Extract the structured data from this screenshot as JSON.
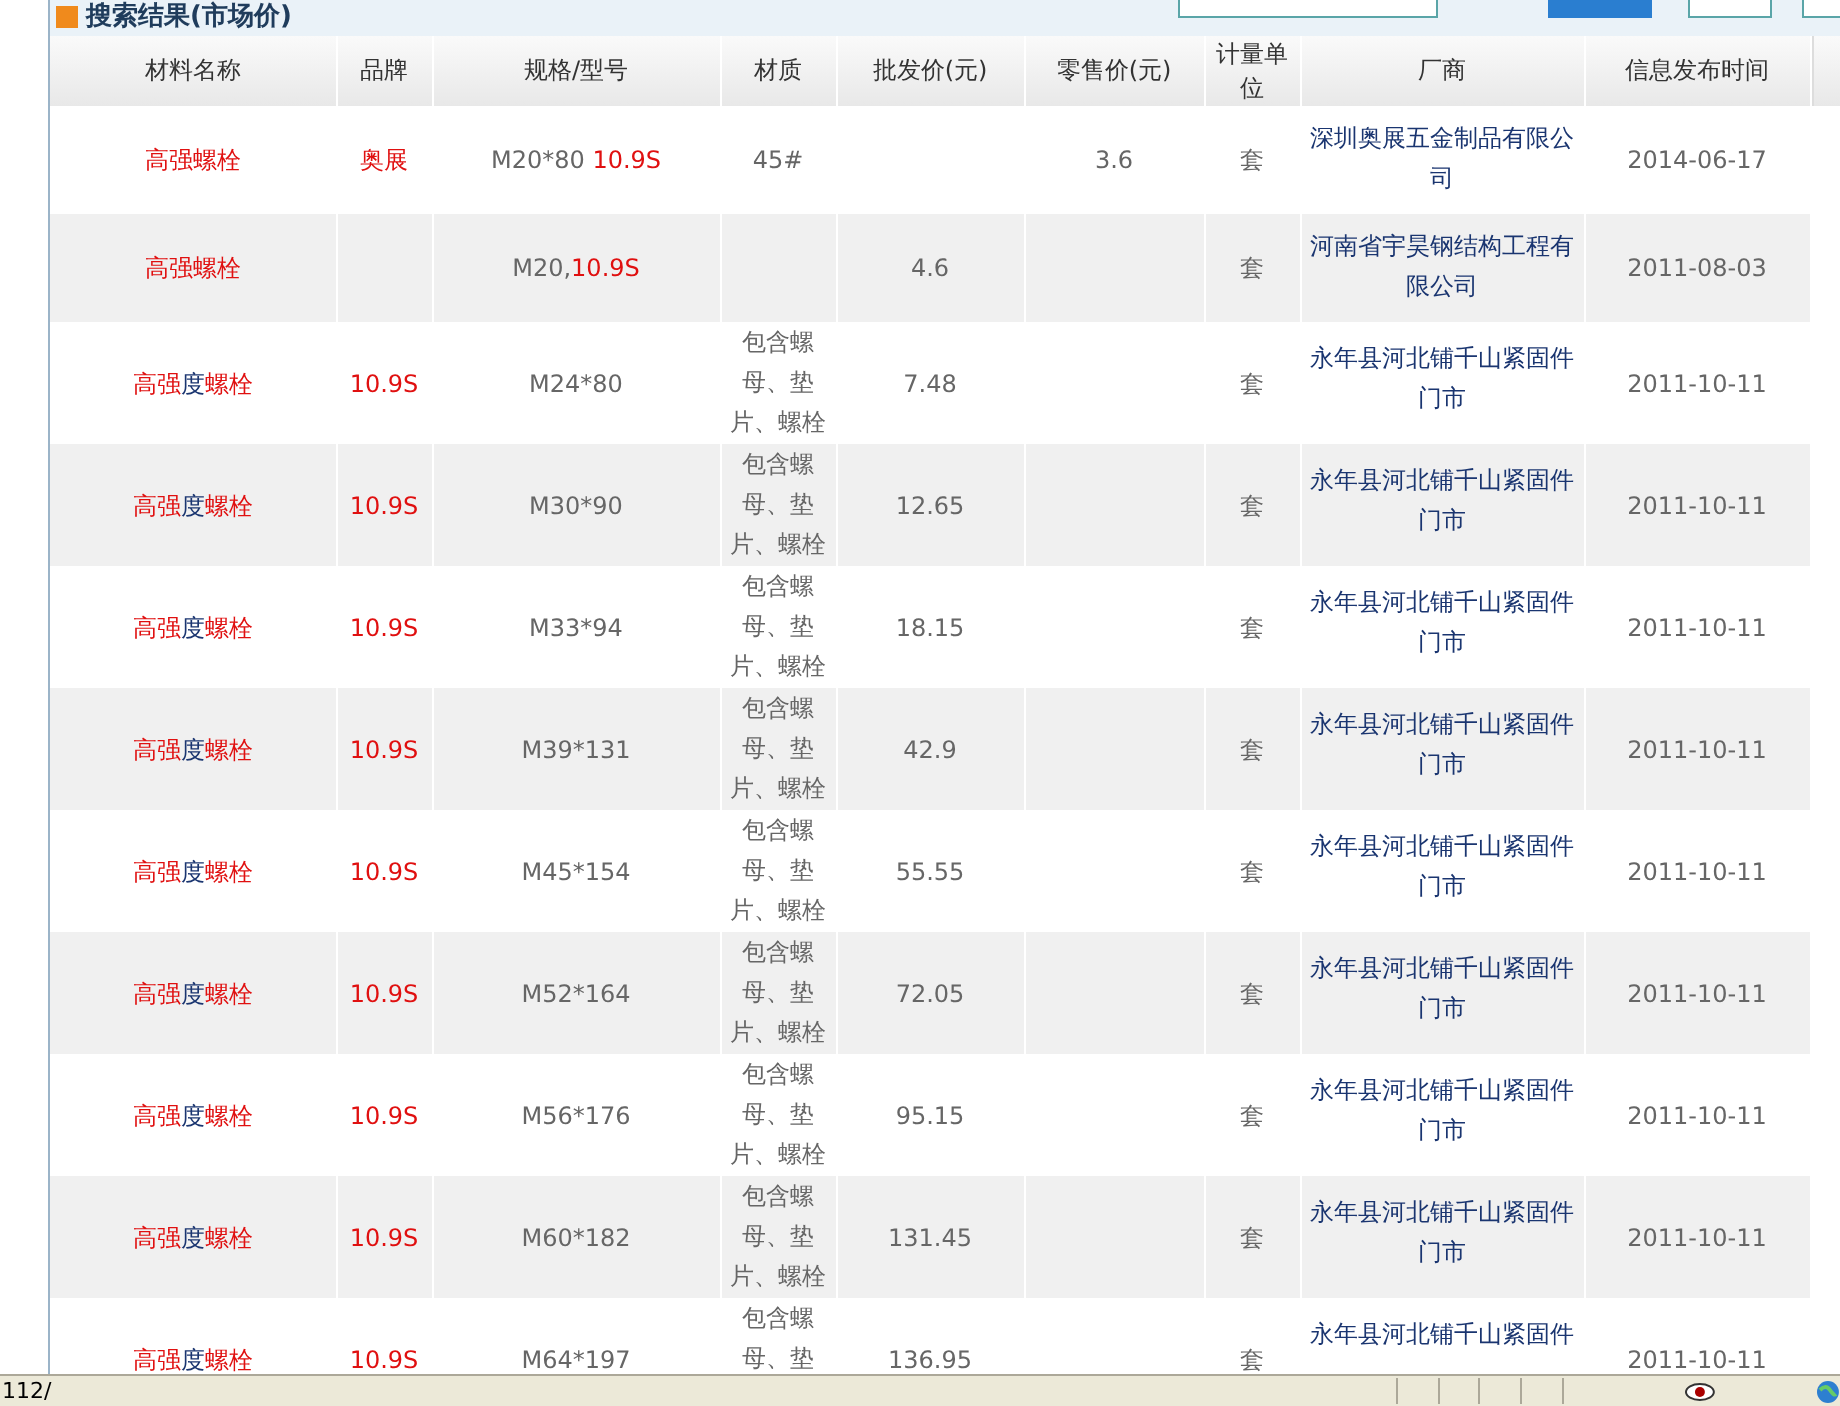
{
  "title": "搜索结果(市场价)",
  "columns": [
    "材料名称",
    "品牌",
    "规格/型号",
    "材质",
    "批发价(元)",
    "零售价(元)",
    "计量单位",
    "厂商",
    "信息发布时间"
  ],
  "rows": [
    {
      "name": [
        {
          "text": "高强螺栓",
          "red": true
        }
      ],
      "brand": "奥展",
      "spec": [
        {
          "text": "M20*80 ",
          "red": false
        },
        {
          "text": "10.9S",
          "red": true
        }
      ],
      "material": "45#",
      "wholesale": "",
      "retail": "3.6",
      "unit": "套",
      "factory": "深圳奥展五金制品有限公司",
      "date": "2014-06-17"
    },
    {
      "name": [
        {
          "text": "高强螺栓",
          "red": true
        }
      ],
      "brand": "",
      "spec": [
        {
          "text": "M20,",
          "red": false
        },
        {
          "text": "10.9S",
          "red": true
        }
      ],
      "material": "",
      "wholesale": "4.6",
      "retail": "",
      "unit": "套",
      "factory": "河南省宇昊钢结构工程有限公司",
      "date": "2011-08-03"
    },
    {
      "name": [
        {
          "text": "高强",
          "red": true
        },
        {
          "text": "度",
          "red": false
        },
        {
          "text": "螺栓",
          "red": true
        }
      ],
      "brand": "10.9S",
      "spec": [
        {
          "text": "M24*80",
          "red": false
        }
      ],
      "material": "包含螺母、垫片、螺栓",
      "wholesale": "7.48",
      "retail": "",
      "unit": "套",
      "factory": "永年县河北铺千山紧固件门市",
      "date": "2011-10-11"
    },
    {
      "name": [
        {
          "text": "高强",
          "red": true
        },
        {
          "text": "度",
          "red": false
        },
        {
          "text": "螺栓",
          "red": true
        }
      ],
      "brand": "10.9S",
      "spec": [
        {
          "text": "M30*90",
          "red": false
        }
      ],
      "material": "包含螺母、垫片、螺栓",
      "wholesale": "12.65",
      "retail": "",
      "unit": "套",
      "factory": "永年县河北铺千山紧固件门市",
      "date": "2011-10-11"
    },
    {
      "name": [
        {
          "text": "高强",
          "red": true
        },
        {
          "text": "度",
          "red": false
        },
        {
          "text": "螺栓",
          "red": true
        }
      ],
      "brand": "10.9S",
      "spec": [
        {
          "text": "M33*94",
          "red": false
        }
      ],
      "material": "包含螺母、垫片、螺栓",
      "wholesale": "18.15",
      "retail": "",
      "unit": "套",
      "factory": "永年县河北铺千山紧固件门市",
      "date": "2011-10-11"
    },
    {
      "name": [
        {
          "text": "高强",
          "red": true
        },
        {
          "text": "度",
          "red": false
        },
        {
          "text": "螺栓",
          "red": true
        }
      ],
      "brand": "10.9S",
      "spec": [
        {
          "text": "M39*131",
          "red": false
        }
      ],
      "material": "包含螺母、垫片、螺栓",
      "wholesale": "42.9",
      "retail": "",
      "unit": "套",
      "factory": "永年县河北铺千山紧固件门市",
      "date": "2011-10-11"
    },
    {
      "name": [
        {
          "text": "高强",
          "red": true
        },
        {
          "text": "度",
          "red": false
        },
        {
          "text": "螺栓",
          "red": true
        }
      ],
      "brand": "10.9S",
      "spec": [
        {
          "text": "M45*154",
          "red": false
        }
      ],
      "material": "包含螺母、垫片、螺栓",
      "wholesale": "55.55",
      "retail": "",
      "unit": "套",
      "factory": "永年县河北铺千山紧固件门市",
      "date": "2011-10-11"
    },
    {
      "name": [
        {
          "text": "高强",
          "red": true
        },
        {
          "text": "度",
          "red": false
        },
        {
          "text": "螺栓",
          "red": true
        }
      ],
      "brand": "10.9S",
      "spec": [
        {
          "text": "M52*164",
          "red": false
        }
      ],
      "material": "包含螺母、垫片、螺栓",
      "wholesale": "72.05",
      "retail": "",
      "unit": "套",
      "factory": "永年县河北铺千山紧固件门市",
      "date": "2011-10-11"
    },
    {
      "name": [
        {
          "text": "高强",
          "red": true
        },
        {
          "text": "度",
          "red": false
        },
        {
          "text": "螺栓",
          "red": true
        }
      ],
      "brand": "10.9S",
      "spec": [
        {
          "text": "M56*176",
          "red": false
        }
      ],
      "material": "包含螺母、垫片、螺栓",
      "wholesale": "95.15",
      "retail": "",
      "unit": "套",
      "factory": "永年县河北铺千山紧固件门市",
      "date": "2011-10-11"
    },
    {
      "name": [
        {
          "text": "高强",
          "red": true
        },
        {
          "text": "度",
          "red": false
        },
        {
          "text": "螺栓",
          "red": true
        }
      ],
      "brand": "10.9S",
      "spec": [
        {
          "text": "M60*182",
          "red": false
        }
      ],
      "material": "包含螺母、垫片、螺栓",
      "wholesale": "131.45",
      "retail": "",
      "unit": "套",
      "factory": "永年县河北铺千山紧固件门市",
      "date": "2011-10-11"
    },
    {
      "name": [
        {
          "text": "高强",
          "red": true
        },
        {
          "text": "度",
          "red": false
        },
        {
          "text": "螺栓",
          "red": true
        }
      ],
      "brand": "10.9S",
      "spec": [
        {
          "text": "M64*197",
          "red": false
        }
      ],
      "material": "包含螺母、垫",
      "wholesale": "136.95",
      "retail": "",
      "unit": "套",
      "factory": "永年县河北铺千山紧固件",
      "date": "2011-10-11"
    }
  ],
  "status_bar": {
    "text": "112/"
  }
}
